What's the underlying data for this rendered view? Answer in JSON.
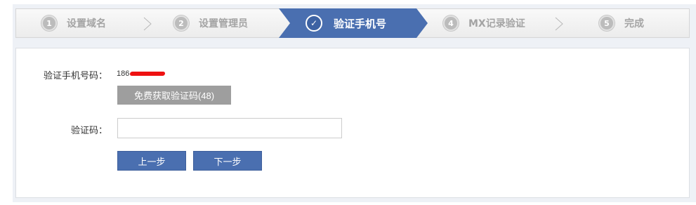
{
  "steps": [
    {
      "number": "1",
      "label": "设置域名"
    },
    {
      "number": "2",
      "label": "设置管理员"
    },
    {
      "number": "3",
      "label": "验证手机号",
      "active": true
    },
    {
      "number": "4",
      "label": "MX记录验证"
    },
    {
      "number": "5",
      "label": "完成"
    }
  ],
  "form": {
    "phone_label": "验证手机号码：",
    "phone_value": "186",
    "get_code_button": "免费获取验证码(48)",
    "code_label": "验证码：",
    "code_value": "",
    "code_placeholder": "",
    "prev_button": "上一步",
    "next_button": "下一步"
  },
  "colors": {
    "active_step": "#4a6fb0",
    "primary_button": "#4a6fb0",
    "disabled_button": "#9e9e9e",
    "inactive_text": "#a4a4a4"
  },
  "icons": {
    "active_step_marker": "check-icon"
  }
}
